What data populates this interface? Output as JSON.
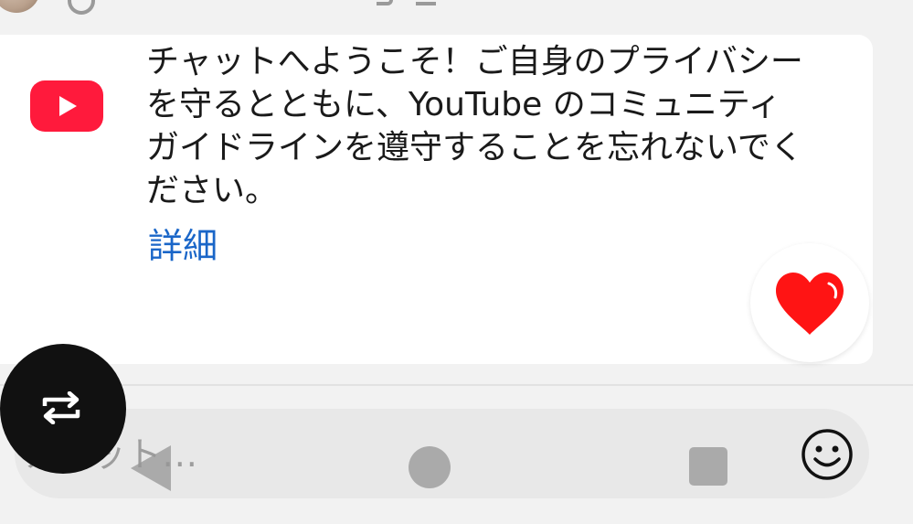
{
  "welcome": {
    "message": "チャットへようこそ！ご自身のプライバシーを守るとともに、YouTube のコミュニティ ガイドラインを遵守することを忘れないでください。",
    "learn_more": "詳細"
  },
  "chat": {
    "placeholder": "チャット..."
  },
  "icons": {
    "brand": "youtube-logo-icon",
    "reaction": "heart-icon",
    "emoji": "smiley-icon",
    "rotate": "repeat-icon",
    "nav_back": "back-triangle-icon",
    "nav_home": "home-circle-icon",
    "nav_recents": "recents-square-icon"
  },
  "colors": {
    "youtube_red": "#ff1a3c",
    "link_blue": "#1a66c8",
    "heart_red": "#ff1414",
    "rotate_button": "#111111"
  }
}
